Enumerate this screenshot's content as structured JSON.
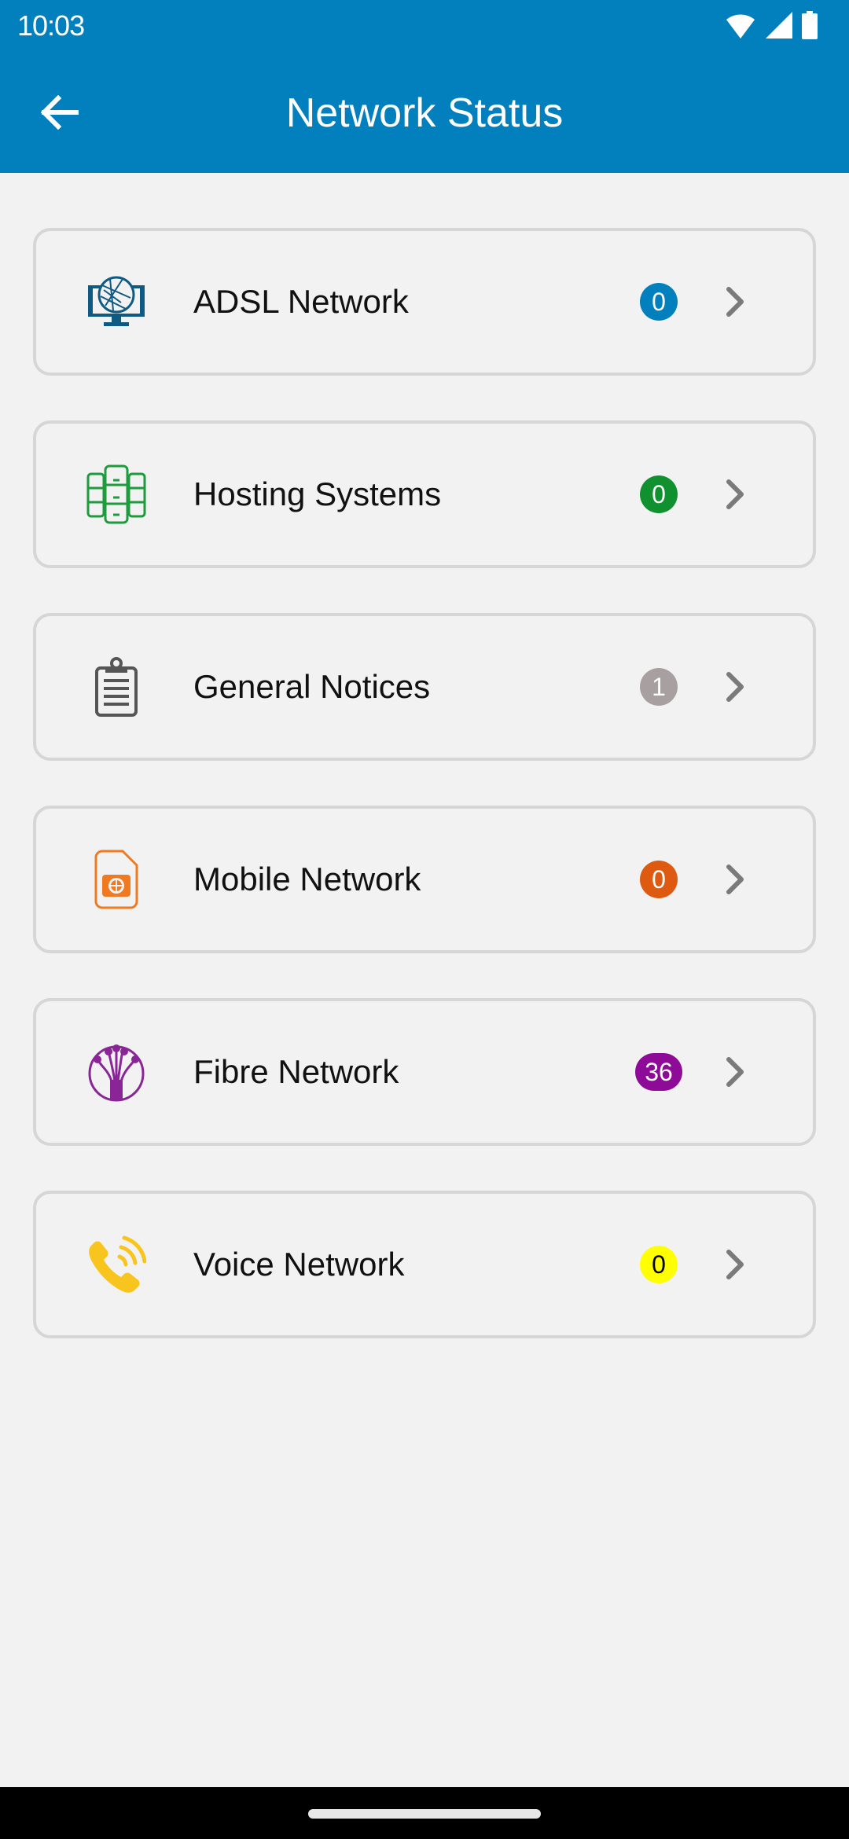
{
  "status_bar": {
    "time": "10:03",
    "icons": [
      "wifi-icon",
      "cellular-signal-icon",
      "battery-icon"
    ]
  },
  "header": {
    "title": "Network Status",
    "back_icon": "arrow-left-icon",
    "background_color": "#0280bd"
  },
  "items": [
    {
      "label": "ADSL Network",
      "icon": "monitor-globe-icon",
      "icon_color": "#0f5a82",
      "count": "0",
      "badge_color": "#0280bd",
      "badge_text_color": "#ffffff"
    },
    {
      "label": "Hosting Systems",
      "icon": "server-rack-icon",
      "icon_color": "#1e9b3c",
      "count": "0",
      "badge_color": "#10902e",
      "badge_text_color": "#ffffff"
    },
    {
      "label": "General Notices",
      "icon": "clipboard-icon",
      "icon_color": "#555555",
      "count": "1",
      "badge_color": "#a8a0a0",
      "badge_text_color": "#ffffff"
    },
    {
      "label": "Mobile Network",
      "icon": "sim-card-icon",
      "icon_color": "#f07a22",
      "count": "0",
      "badge_color": "#dd5a10",
      "badge_text_color": "#ffffff"
    },
    {
      "label": "Fibre Network",
      "icon": "fibre-optic-icon",
      "icon_color": "#8a2597",
      "count": "36",
      "badge_color": "#8e0b98",
      "badge_text_color": "#ffffff"
    },
    {
      "label": "Voice Network",
      "icon": "phone-ringing-icon",
      "icon_color": "#f7c51e",
      "count": "0",
      "badge_color": "#ffff00",
      "badge_text_color": "#000000"
    }
  ],
  "chevron_icon": "chevron-right-icon"
}
